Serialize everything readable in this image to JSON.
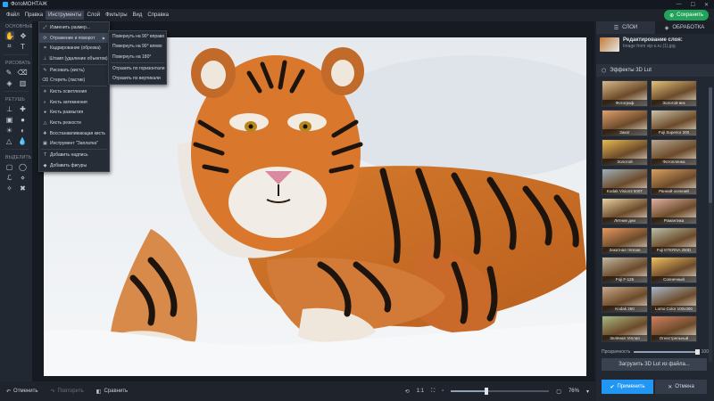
{
  "window": {
    "title": "ФотоМОНТАЖ"
  },
  "menubar": {
    "items": [
      "Файл",
      "Правка",
      "Инструменты",
      "Слой",
      "Фильтры",
      "Вид",
      "Справка"
    ],
    "active_index": 2,
    "save_label": "Сохранить"
  },
  "toolpanel": {
    "sections": [
      "ОСНОВНЫЕ",
      "РИСОВАТЬ",
      "РЕТУШЬ",
      "ВЫДЕЛИТЬ"
    ]
  },
  "tools_menu": {
    "items": [
      {
        "label": "Изменить размер...",
        "icon": "resize-icon"
      },
      {
        "label": "Отражение и поворот",
        "icon": "rotate-icon",
        "submenu": true
      },
      {
        "label": "Кадрирование (обрезка)",
        "icon": "crop-icon"
      },
      {
        "label": "Штамп (удаление объектов)",
        "icon": "stamp-icon"
      },
      {
        "label": "Рисовать (кисть)",
        "icon": "brush-icon"
      },
      {
        "label": "Стереть (ластик)",
        "icon": "eraser-icon"
      },
      {
        "label": "Кисть осветления",
        "icon": "dodge-icon"
      },
      {
        "label": "Кисть затемнения",
        "icon": "burn-icon"
      },
      {
        "label": "Кисть размытия",
        "icon": "blur-icon"
      },
      {
        "label": "Кисть резкости",
        "icon": "sharpen-icon"
      },
      {
        "label": "Восстанавливающая кисть",
        "icon": "healing-icon"
      },
      {
        "label": "Инструмент \"Заплатка\"",
        "icon": "patch-icon"
      },
      {
        "label": "Добавить надпись",
        "icon": "text-icon"
      },
      {
        "label": "Добавить фигуры",
        "icon": "shapes-icon"
      }
    ]
  },
  "rotate_submenu": {
    "items": [
      "Повернуть на 90° вправо",
      "Повернуть на 90° влево",
      "Повернуть на 180°",
      "Отразить по горизонтали",
      "Отразить по вертикали"
    ]
  },
  "right_panel": {
    "tabs": [
      "СЛОИ",
      "ОБРАБОТКА"
    ],
    "active_tab": 0,
    "layer_title": "Редактирование слоя:",
    "layer_subtitle": "Image from vip-s.ru (1).jpg",
    "effects_title": "Эффекты 3D Lut",
    "luts": [
      {
        "label": "Фотограф",
        "tint": "#d8b98a"
      },
      {
        "label": "Золотой век",
        "tint": "#e2c27a"
      },
      {
        "label": "Закат",
        "tint": "#e0a070"
      },
      {
        "label": "Fuji Superior 200",
        "tint": "#c9c2a8"
      },
      {
        "label": "Золотой",
        "tint": "#e8b850"
      },
      {
        "label": "Фотопленка",
        "tint": "#b8a890"
      },
      {
        "label": "Kodak Vision3 500T 5219",
        "tint": "#9fb0b8"
      },
      {
        "label": "Ранний осенний",
        "tint": "#d9a060"
      },
      {
        "label": "Летние дни",
        "tint": "#e8d0a0"
      },
      {
        "label": "Романтика",
        "tint": "#e0b0a0"
      },
      {
        "label": "Закатная тёплая",
        "tint": "#e89860"
      },
      {
        "label": "Fuji ETERNA 250D",
        "tint": "#b8c0a8"
      },
      {
        "label": "Fuji F-125",
        "tint": "#c0b8a0"
      },
      {
        "label": "Солнечный",
        "tint": "#f0c060"
      },
      {
        "label": "Kodak 250",
        "tint": "#c8a888"
      },
      {
        "label": "Lomo Color 100x300",
        "tint": "#a8b8c8"
      },
      {
        "label": "Зелёная тёплая",
        "tint": "#a8b880"
      },
      {
        "label": "Огнестрельный эффект",
        "tint": "#d08060"
      }
    ],
    "opacity_label": "Прозрачность",
    "opacity_value": "100",
    "opacity_fraction": 1.0,
    "load_label": "Загрузить 3D Lut из файла...",
    "apply_label": "Применить",
    "cancel_label": "Отмена"
  },
  "bottombar": {
    "undo_label": "Отменить",
    "redo_label": "Повторить",
    "compare_label": "Сравнить",
    "ratio_label": "1:1",
    "zoom_value": "76%",
    "zoom_fraction": 0.36
  }
}
